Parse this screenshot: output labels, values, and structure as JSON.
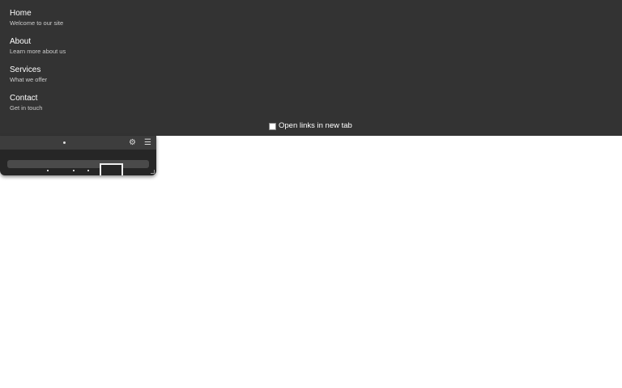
{
  "nav": {
    "items": [
      {
        "label": "Home",
        "description": "Welcome to our site"
      },
      {
        "label": "About",
        "description": "Learn more about us"
      },
      {
        "label": "Services",
        "description": "What we offer"
      },
      {
        "label": "Contact",
        "description": "Get in touch"
      }
    ],
    "open_new_tab_label": "Open links in new tab",
    "open_new_tab_checked": false
  },
  "widget": {
    "icons": [
      "drag-handle-icon",
      "gear-icon",
      "menu-icon"
    ],
    "settings_glyph": "⚙",
    "menu_glyph": "☰"
  },
  "colors": {
    "nav_background": "#333333",
    "widget_background": "#262626",
    "widget_titlebar": "#3d3d3d"
  }
}
